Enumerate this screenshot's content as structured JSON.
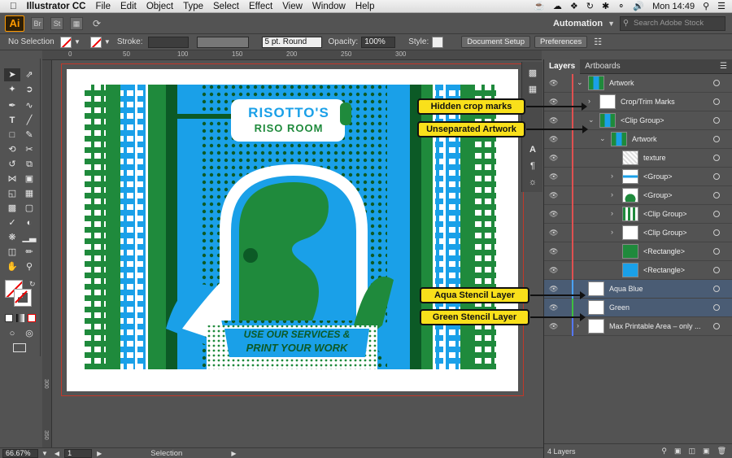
{
  "menubar": {
    "app_name": "Illustrator CC",
    "items": [
      "File",
      "Edit",
      "Object",
      "Type",
      "Select",
      "Effect",
      "View",
      "Window",
      "Help"
    ],
    "clock": "Mon 14:49"
  },
  "appbar": {
    "logo": "Ai",
    "br_label": "Br",
    "st_label": "St",
    "workspace": "Automation",
    "stock_placeholder": "Search Adobe Stock"
  },
  "controlbar": {
    "selection": "No Selection",
    "stroke_label": "Stroke:",
    "brush": "5 pt. Round",
    "opacity_label": "Opacity:",
    "opacity_value": "100%",
    "style_label": "Style:",
    "doc_setup": "Document Setup",
    "preferences": "Preferences"
  },
  "ruler": {
    "top_ticks": [
      "0",
      "50",
      "100",
      "150",
      "200",
      "250",
      "300"
    ],
    "left_ticks": [
      "300",
      "350"
    ]
  },
  "artwork": {
    "title_line1": "RISOTTO'S",
    "title_line2": "RISO ROOM",
    "banner_line1": "USE OUR SERVICES &",
    "banner_line2": "PRINT YOUR WORK"
  },
  "statusbar": {
    "zoom": "66.67%",
    "page": "1",
    "tool": "Selection"
  },
  "panel": {
    "tabs": [
      "Layers",
      "Artboards"
    ],
    "footer": "4 Layers",
    "rows": [
      {
        "name": "Artwork",
        "indent": 0,
        "expand": "v",
        "color": "#e05050",
        "thumb": "art"
      },
      {
        "name": "Crop/Trim Marks",
        "indent": 1,
        "expand": ">",
        "color": "#e05050",
        "thumb": "white"
      },
      {
        "name": "<Clip Group>",
        "indent": 1,
        "expand": "v",
        "color": "#e05050",
        "thumb": "art"
      },
      {
        "name": "Artwork",
        "indent": 2,
        "expand": "v",
        "color": "#e05050",
        "thumb": "art"
      },
      {
        "name": "texture",
        "indent": 3,
        "expand": "",
        "color": "#e05050",
        "thumb": "texture"
      },
      {
        "name": "<Group>",
        "indent": 3,
        "expand": ">",
        "color": "#e05050",
        "thumb": "stripe"
      },
      {
        "name": "<Group>",
        "indent": 3,
        "expand": ">",
        "color": "#e05050",
        "thumb": "arch"
      },
      {
        "name": "<Clip Group>",
        "indent": 3,
        "expand": ">",
        "color": "#e05050",
        "thumb": "bars"
      },
      {
        "name": "<Clip Group>",
        "indent": 3,
        "expand": ">",
        "color": "#e05050",
        "thumb": "white"
      },
      {
        "name": "<Rectangle>",
        "indent": 3,
        "expand": "",
        "color": "#e05050",
        "thumb": "green"
      },
      {
        "name": "<Rectangle>",
        "indent": 3,
        "expand": "",
        "color": "#e05050",
        "thumb": "blue"
      },
      {
        "name": "Aqua Blue",
        "indent": 0,
        "expand": "",
        "color": "#4aa3ff",
        "thumb": "white",
        "selected": true
      },
      {
        "name": "Green",
        "indent": 0,
        "expand": "",
        "color": "#3fbf3f",
        "thumb": "white",
        "selected": true
      },
      {
        "name": "Max Printable Area – only ...",
        "indent": 0,
        "expand": ">",
        "color": "#5577ff",
        "thumb": "white"
      }
    ]
  },
  "callouts": {
    "hidden_crop": "Hidden crop marks",
    "unseparated": "Unseparated Artwork",
    "aqua": "Aqua Stencil Layer",
    "green": "Green Stencil Layer"
  },
  "colors": {
    "riso_green": "#1f8a3c",
    "riso_blue": "#1aa0e8",
    "callout": "#f9e01b"
  }
}
